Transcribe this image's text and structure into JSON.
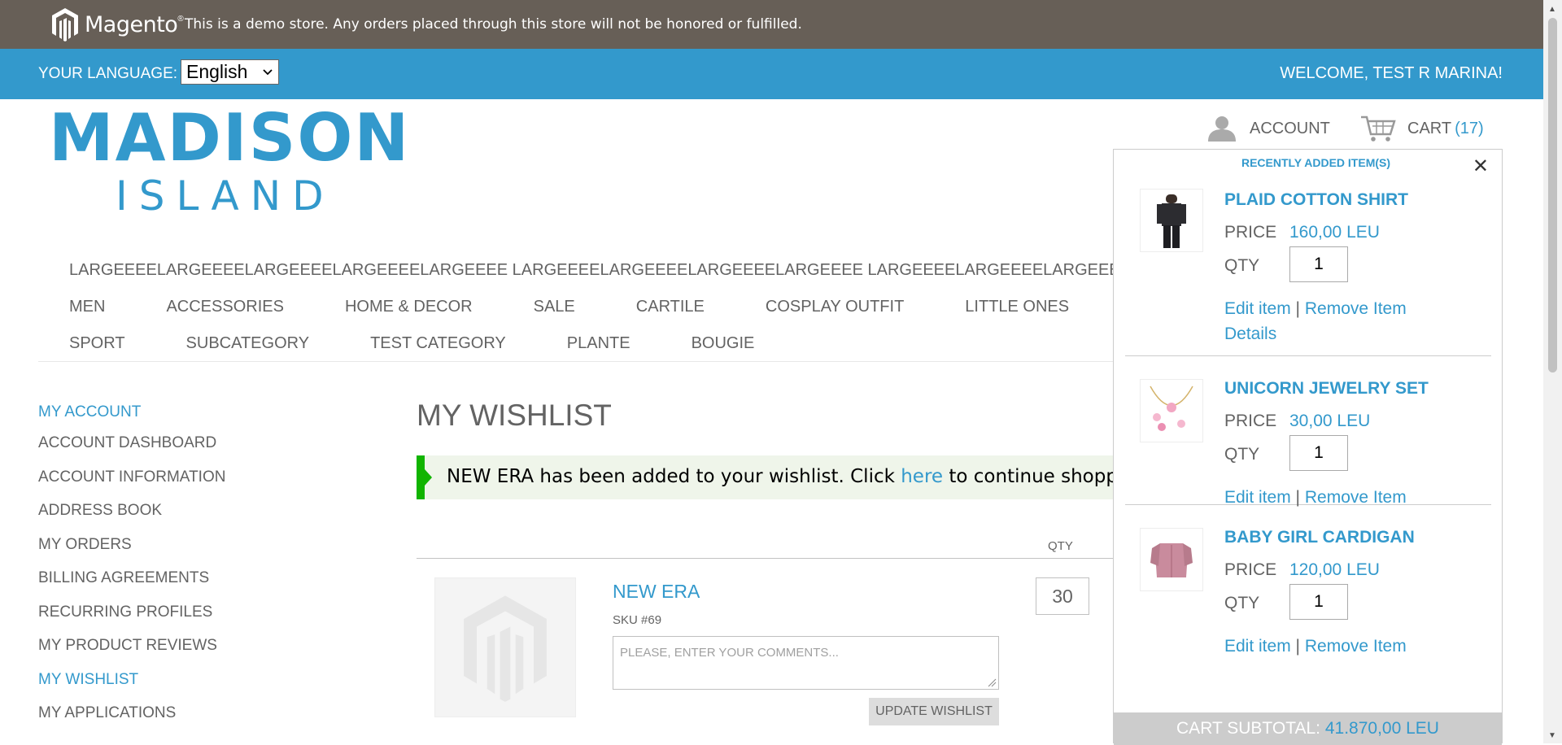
{
  "demo_bar": {
    "logo_text": "Magento",
    "message": "This is a demo store. Any orders placed through this store will not be honored or fulfilled."
  },
  "lang_bar": {
    "label": "YOUR LANGUAGE:",
    "selected_language": "English",
    "welcome": "WELCOME, TEST R MARINA!"
  },
  "header": {
    "logo_line1": "MADISON",
    "logo_line2": "ISLAND",
    "account_label": "ACCOUNT",
    "cart_label": "CART",
    "cart_count": "(17)"
  },
  "nav": {
    "row0": "LARGEEEELARGEEEELARGEEEELARGEEEELARGEEEE LARGEEEELARGEEEELARGEEEELARGEEEE LARGEEEELARGEEEELARGEEEELARGEEEE",
    "row1": [
      "MEN",
      "ACCESSORIES",
      "HOME & DECOR",
      "SALE",
      "CARTILE",
      "COSPLAY OUTFIT",
      "LITTLE ONES"
    ],
    "row2": [
      "SPORT",
      "SUBCATEGORY",
      "TEST CATEGORY",
      "PLANTE",
      "BOUGIE"
    ]
  },
  "sidebar": {
    "title": "MY ACCOUNT",
    "items": [
      "ACCOUNT DASHBOARD",
      "ACCOUNT INFORMATION",
      "ADDRESS BOOK",
      "MY ORDERS",
      "BILLING AGREEMENTS",
      "RECURRING PROFILES",
      "MY PRODUCT REVIEWS",
      "MY WISHLIST",
      "MY APPLICATIONS"
    ],
    "active": "MY WISHLIST"
  },
  "main": {
    "title": "MY WISHLIST",
    "message_before": "NEW ERA has been added to your wishlist. Click ",
    "message_link": "here",
    "message_after": " to continue shopping.",
    "qty_header": "QTY",
    "product": {
      "name": "NEW ERA",
      "sku": "SKU #69",
      "comment_placeholder": "PLEASE, ENTER YOUR COMMENTS...",
      "qty": "30"
    },
    "update_button": "UPDATE WISHLIST"
  },
  "minicart": {
    "title": "RECENTLY ADDED ITEM(S)",
    "close": "✕",
    "price_label": "PRICE",
    "qty_label": "QTY",
    "edit_label": "Edit item",
    "separator": "|",
    "remove_label": "Remove Item",
    "details_label": "Details",
    "items": [
      {
        "name": "PLAID COTTON SHIRT",
        "price": "160,00 LEU",
        "qty": "1"
      },
      {
        "name": "UNICORN JEWELRY SET",
        "price": "30,00 LEU",
        "qty": "1"
      },
      {
        "name": "BABY GIRL CARDIGAN",
        "price": "120,00 LEU",
        "qty": "1"
      }
    ],
    "subtotal_label": "CART SUBTOTAL:",
    "subtotal_value": "41.870,00 LEU"
  }
}
